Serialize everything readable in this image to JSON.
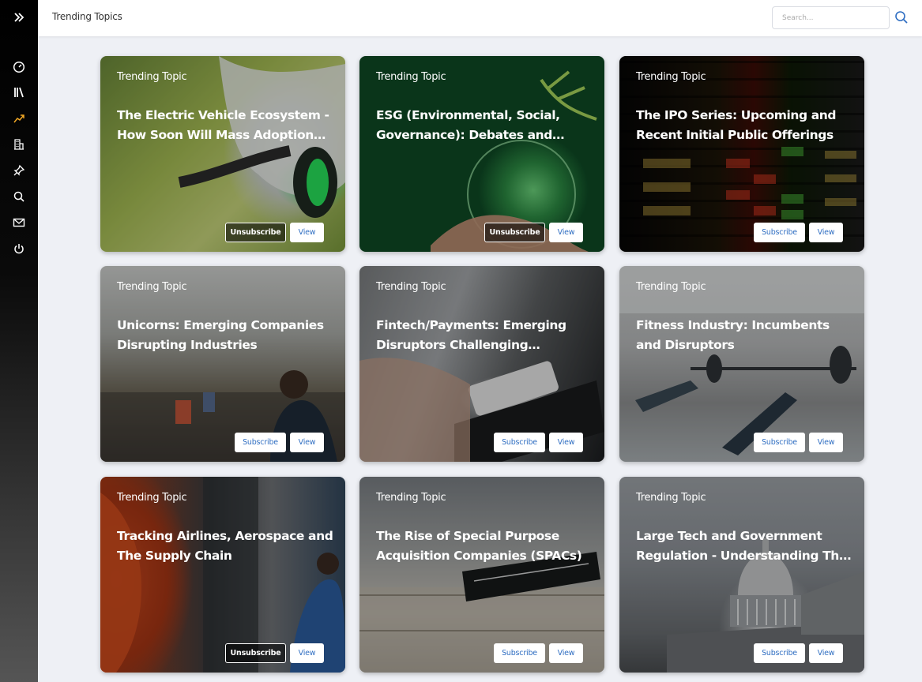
{
  "header": {
    "title": "Trending Topics",
    "search_placeholder": "Search..."
  },
  "sidebar": {
    "items": [
      {
        "icon": "expand-icon"
      },
      {
        "icon": "dashboard-icon"
      },
      {
        "icon": "library-icon"
      },
      {
        "icon": "trending-icon",
        "active": true
      },
      {
        "icon": "companies-icon"
      },
      {
        "icon": "pin-icon"
      },
      {
        "icon": "search-icon"
      },
      {
        "icon": "mail-icon"
      },
      {
        "icon": "power-icon"
      }
    ],
    "active_color": "#f2a825"
  },
  "cards": [
    {
      "tag": "Trending Topic",
      "title": "The Electric Vehicle Ecosystem - How Soon Will Mass Adoption Happen?",
      "action": "Unsubscribe",
      "view": "View"
    },
    {
      "tag": "Trending Topic",
      "title": "ESG (Environmental, Social, Governance): Debates and Developments",
      "action": "Unsubscribe",
      "view": "View"
    },
    {
      "tag": "Trending Topic",
      "title": "The IPO Series: Upcoming and Recent Initial Public Offerings",
      "action": "Subscribe",
      "view": "View"
    },
    {
      "tag": "Trending Topic",
      "title": "Unicorns: Emerging Companies Disrupting Industries",
      "action": "Subscribe",
      "view": "View"
    },
    {
      "tag": "Trending Topic",
      "title": "Fintech/Payments: Emerging Disruptors Challenging Incumbents",
      "action": "Subscribe",
      "view": "View"
    },
    {
      "tag": "Trending Topic",
      "title": "Fitness Industry: Incumbents and Disruptors",
      "action": "Subscribe",
      "view": "View"
    },
    {
      "tag": "Trending Topic",
      "title": "Tracking Airlines, Aerospace and The Supply Chain",
      "action": "Unsubscribe",
      "view": "View"
    },
    {
      "tag": "Trending Topic",
      "title": "The Rise of Special Purpose Acquisition Companies (SPACs)",
      "action": "Subscribe",
      "view": "View"
    },
    {
      "tag": "Trending Topic",
      "title": "Large Tech and Government Regulation - Understanding The Landscape",
      "action": "Subscribe",
      "view": "View"
    }
  ],
  "colors": {
    "accent": "#2f6ec2",
    "background": "#eef0f5"
  }
}
